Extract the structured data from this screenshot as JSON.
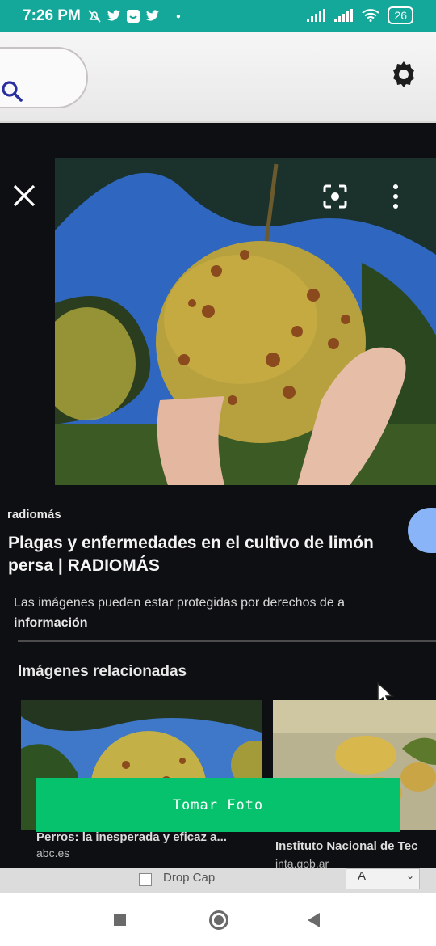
{
  "status_bar": {
    "time": "7:26 PM",
    "battery": "26",
    "notification_icons": [
      "do-not-disturb-icon",
      "twitter-icon",
      "messages-icon",
      "twitter-icon",
      "dot-icon"
    ],
    "right_icons": [
      "signal-icon",
      "signal-icon",
      "wifi-icon"
    ]
  },
  "google_lens": {
    "source": "radiomás",
    "title": "Plagas y enfermedades en el cultivo de limón persa | RADIOMÁS",
    "copyright_notice": "Las imágenes pueden estar protegidas por derechos de a",
    "info_link": "información",
    "related_heading": "Imágenes relacionadas",
    "related": [
      {
        "caption": "Perros: la inesperada y eficaz a...",
        "site": "abc.es"
      },
      {
        "caption": "Instituto Nacional de Tec",
        "site": "inta.gob.ar"
      }
    ]
  },
  "overlay_button": {
    "label": "Tomar Foto"
  },
  "background_doc": {
    "dropcap_label": "Drop Cap",
    "font_preview": "A"
  },
  "nav": {
    "items": [
      "recents-button",
      "home-button",
      "back-button"
    ]
  },
  "colors": {
    "status_bar": "#13a89a",
    "button": "#06c26d",
    "lens_panel": "#0e0f12",
    "visit_button": "#8ab4f8"
  }
}
